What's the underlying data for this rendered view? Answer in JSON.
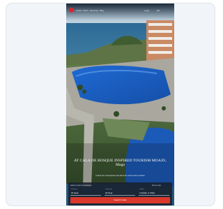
{
  "nav": {
    "items": [
      "Hotels",
      "Offers",
      "Meetings",
      "Blog"
    ],
    "right_items": [
      "Login",
      "EN"
    ]
  },
  "hero": {
    "title": "AT CALA DE BOSQUE INSPIRED TOURISM MOAJO, Maga",
    "subtitle": "A short line of descriptive text about the resort and its location"
  },
  "booking": {
    "heading": "Search a hotel or destination",
    "promo_label": "Promo code",
    "fields": [
      {
        "label": "Check-in",
        "value": "01 Sept"
      },
      {
        "label": "Check-out",
        "value": "04 Sept"
      },
      {
        "label": "Guests",
        "value": "2 Adults, 0 Child"
      }
    ],
    "button_label": "Search hotels"
  },
  "colors": {
    "brand": "#d9262e",
    "button": "#d9382a",
    "pool": "#1f63c4",
    "panel": "#18202c"
  }
}
